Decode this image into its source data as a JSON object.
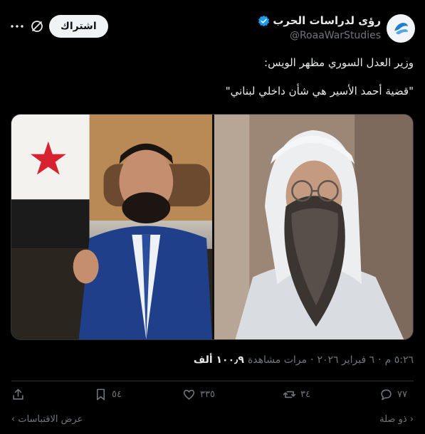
{
  "account": {
    "display_name": "رؤى لدراسات الحرب",
    "handle": "@RoaaWarStudies",
    "verified": true
  },
  "header": {
    "subscribe_label": "اشتراك"
  },
  "tweet": {
    "text_line1": "وزير العدل السوري مظهر الويس:",
    "text_line2": "\"قضية أحمد الأسير هي شأن داخلي لبناني\""
  },
  "meta": {
    "time": "٥:٢٦ م",
    "date": "٦ فبراير ٢٠٢٦",
    "views_count": "١٠٠٫٩ ألف",
    "views_label": "مرات مشاهدة",
    "separator": "·"
  },
  "actions": {
    "replies": "٧٧",
    "reposts": "٣٤",
    "likes": "٣٣٥",
    "bookmarks": "٥٤"
  },
  "footer": {
    "related_label": "ذو صلة",
    "quotes_label": "عرض الاقتباسات"
  },
  "colors": {
    "background": "#000000",
    "text": "#e7e9ea",
    "muted": "#71767b",
    "verified": "#1d9bf0",
    "button_bg": "#eff3f4"
  }
}
